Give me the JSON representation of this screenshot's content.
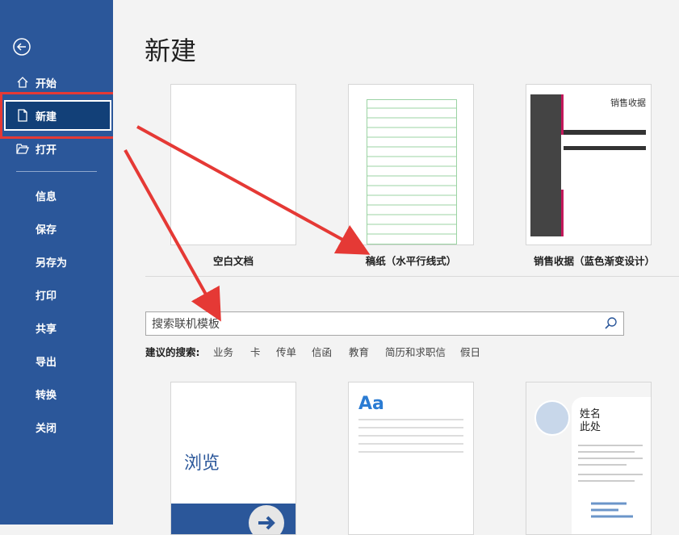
{
  "sidebar": {
    "items": [
      {
        "label": "开始",
        "icon": "home-icon"
      },
      {
        "label": "新建",
        "icon": "new-document-icon",
        "active": true
      },
      {
        "label": "打开",
        "icon": "folder-open-icon"
      }
    ],
    "secondary": [
      "信息",
      "保存",
      "另存为",
      "打印",
      "共享",
      "导出",
      "转换",
      "关闭"
    ]
  },
  "main": {
    "title": "新建",
    "templates_top": [
      {
        "caption": "空白文档"
      },
      {
        "caption": "稿纸（水平行线式）"
      },
      {
        "caption": "销售收据（蓝色渐变设计）",
        "thumb_title": "销售收据"
      }
    ],
    "search": {
      "placeholder": "搜索联机模板"
    },
    "suggested": {
      "heading": "建议的搜索:",
      "items": [
        "业务",
        "卡",
        "传单",
        "信函",
        "教育",
        "简历和求职信",
        "假日"
      ]
    },
    "templates_bottom": [
      {
        "thumb_text": "浏览"
      },
      {
        "thumb_text": "Aa"
      },
      {
        "thumb_name_1": "姓名",
        "thumb_name_2": "此处"
      }
    ]
  },
  "colors": {
    "sidebar": "#2b579a",
    "active": "#124078",
    "annotation": "#e53935",
    "accent": "#2b579a"
  }
}
